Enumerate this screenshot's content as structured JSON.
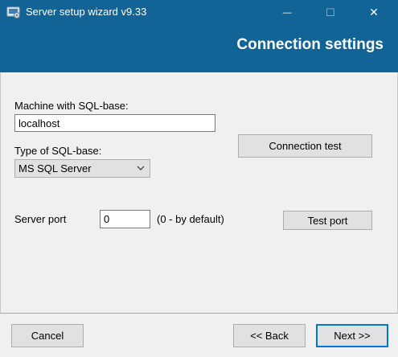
{
  "window": {
    "title": "Server setup wizard v9.33",
    "minimize_glyph": "—",
    "maximize_glyph": "☐",
    "close_glyph": "✕"
  },
  "header": {
    "title": "Connection settings"
  },
  "form": {
    "machine_label": "Machine with SQL-base:",
    "machine_value": "localhost",
    "type_label": "Type of SQL-base:",
    "type_selected": "MS SQL Server",
    "port_label": "Server port",
    "port_value": "0",
    "port_hint": "(0 - by default)"
  },
  "buttons": {
    "connection_test": "Connection test",
    "test_port": "Test port",
    "cancel": "Cancel",
    "back": "<< Back",
    "next": "Next >>"
  },
  "colors": {
    "title_bar": "#126496",
    "window_bg": "#f0f0f0",
    "primary_border": "#0078d7"
  },
  "icons": {
    "app": "app-setup-icon",
    "dropdown": "chevron-down-icon"
  }
}
